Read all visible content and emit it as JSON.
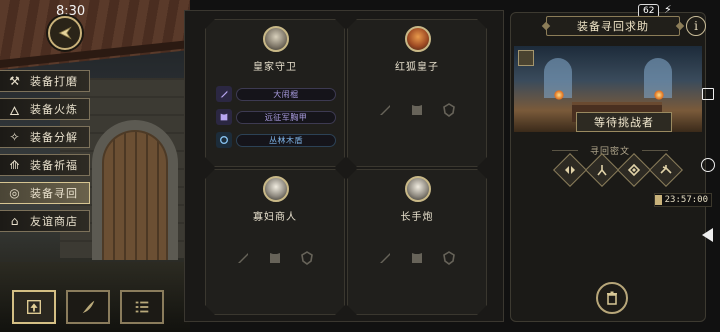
{
  "status": {
    "time": "8:30",
    "battery": "62"
  },
  "menu": {
    "items": [
      {
        "label": "装备打磨",
        "icon": "hammer-icon",
        "glyph": "⚒"
      },
      {
        "label": "装备火炼",
        "icon": "flame-icon",
        "glyph": "🜂"
      },
      {
        "label": "装备分解",
        "icon": "split-icon",
        "glyph": "✧"
      },
      {
        "label": "装备祈福",
        "icon": "prayer-icon",
        "glyph": "⟰"
      },
      {
        "label": "装备寻回",
        "icon": "recall-icon",
        "glyph": "◎"
      },
      {
        "label": "友谊商店",
        "icon": "shop-icon",
        "glyph": "⌂"
      }
    ],
    "active_index": 4
  },
  "cards": [
    {
      "name": "皇家守卫",
      "portrait": "knight-portrait",
      "equips": [
        {
          "label": "大闹棍",
          "tier": "purple"
        },
        {
          "label": "远征军胸甲",
          "tier": "purple"
        },
        {
          "label": "丛林木盾",
          "tier": "blue"
        }
      ]
    },
    {
      "name": "红狐皇子",
      "portrait": "fox-portrait",
      "equips": []
    },
    {
      "name": "寡妇商人",
      "portrait": "widow-portrait",
      "equips": []
    },
    {
      "name": "长手炮",
      "portrait": "cannon-portrait",
      "equips": []
    }
  ],
  "right": {
    "title": "装备寻回求助",
    "info": "i",
    "challenger": "等待挑战者",
    "runes_label": "寻回密文",
    "timer": "23:57:00"
  }
}
